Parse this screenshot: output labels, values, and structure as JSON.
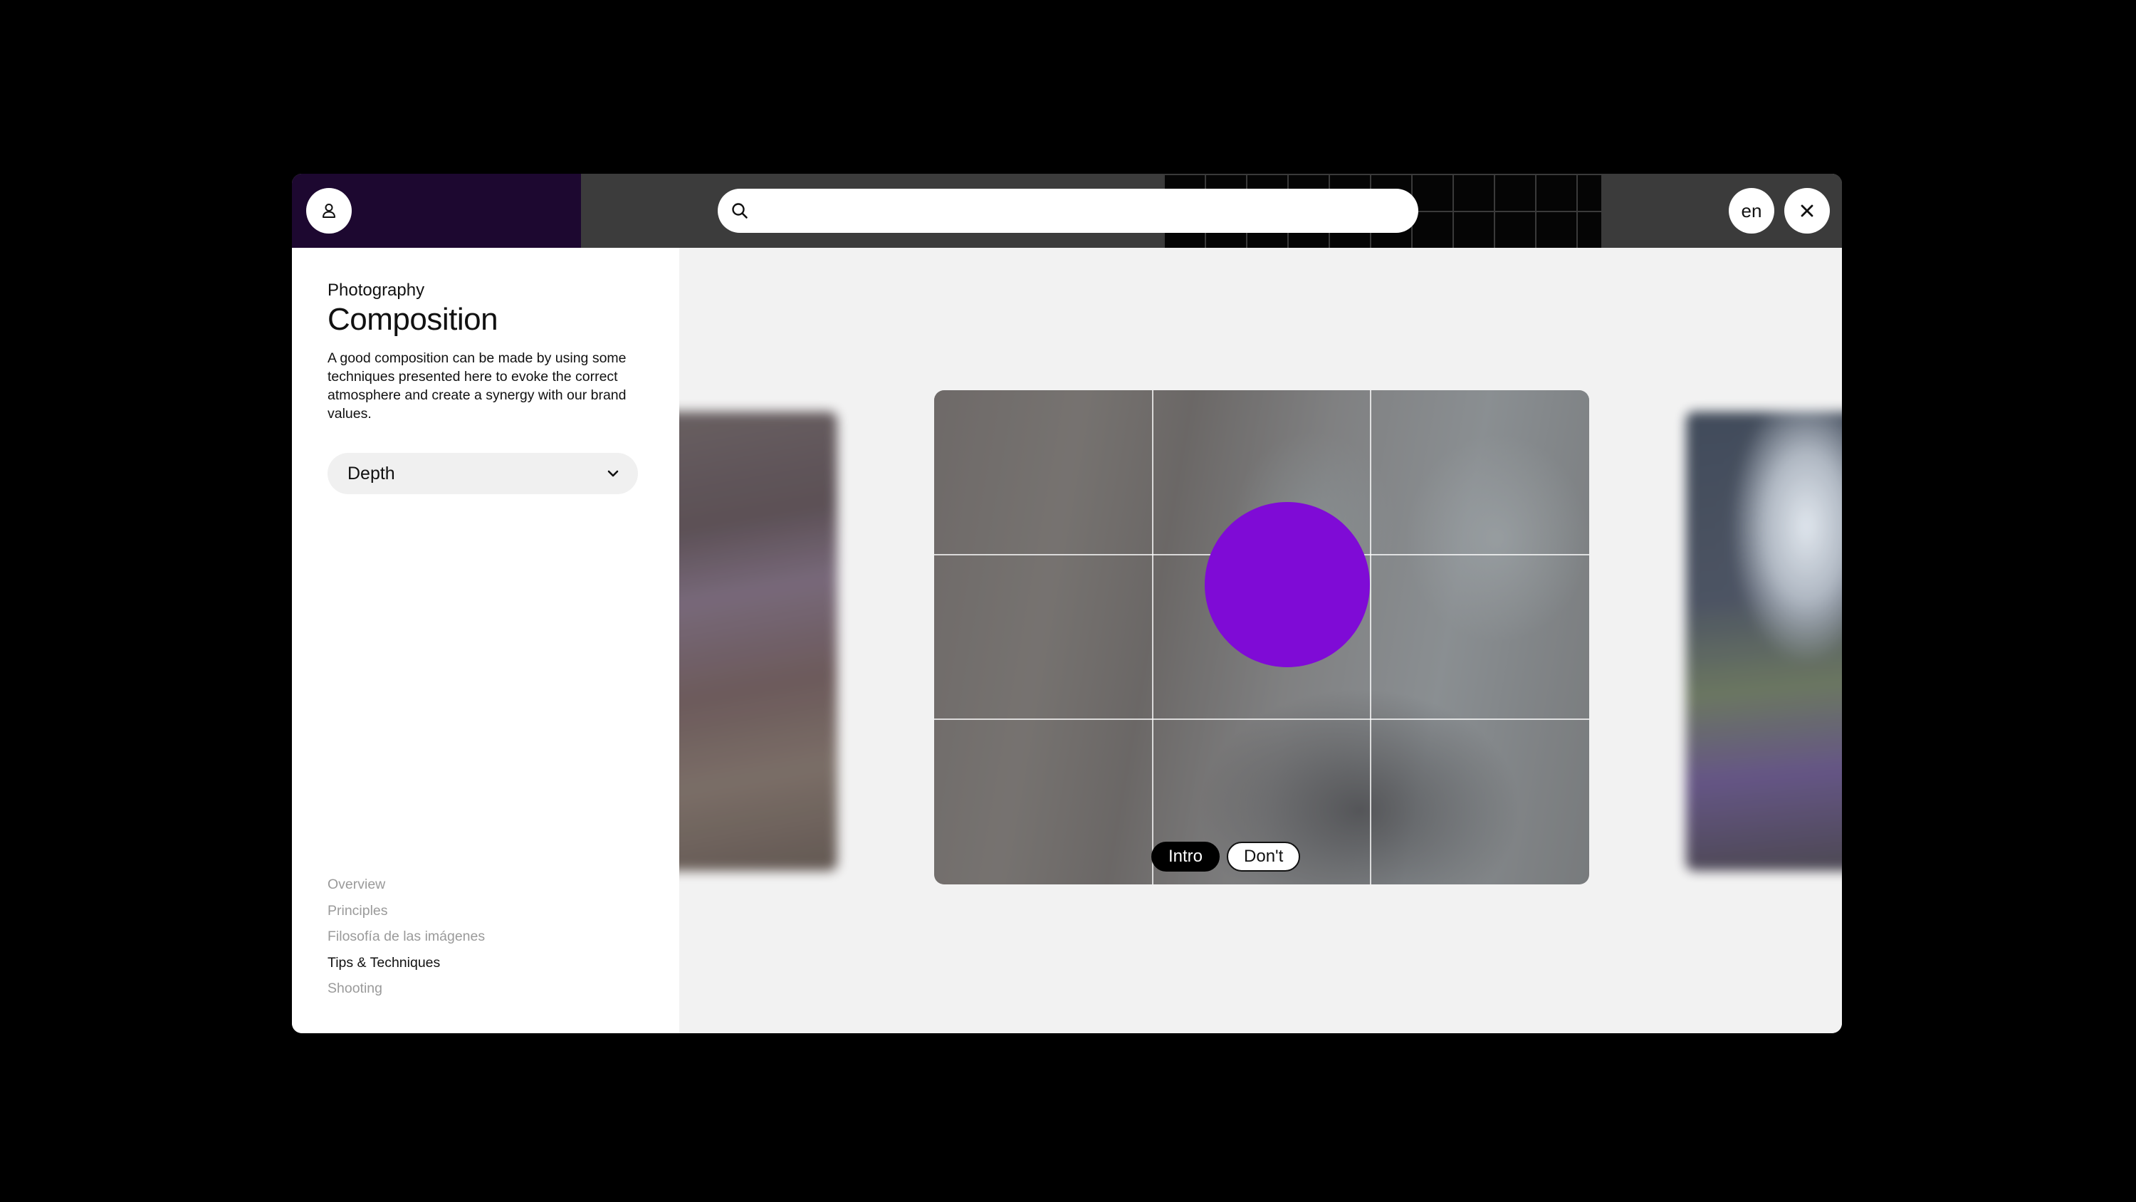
{
  "header": {
    "search": {
      "placeholder": ""
    },
    "language": "en"
  },
  "sidebar": {
    "breadcrumb": "Photography",
    "title": "Composition",
    "description": "A good composition can be made by using some techniques presented here to evoke the correct atmosphere and create a synergy with our brand values.",
    "dropdown": {
      "selected": "Depth"
    },
    "nav": [
      {
        "label": "Overview",
        "active": false
      },
      {
        "label": "Principles",
        "active": false
      },
      {
        "label": "Filosofía de las imágenes",
        "active": false
      },
      {
        "label": "Tips & Techniques",
        "active": true
      },
      {
        "label": "Shooting",
        "active": false
      }
    ]
  },
  "stage": {
    "tabs": [
      {
        "label": "Intro",
        "active": true
      },
      {
        "label": "Don't",
        "active": false
      }
    ],
    "focus_color": "#7f0bd6"
  },
  "colors": {
    "topbar_purple": "#1d0830",
    "focus_purple": "#7f0bd6"
  },
  "icons": {
    "user": "user-icon",
    "search": "search-icon",
    "close": "close-icon",
    "dropdown": "chevron-down-icon"
  }
}
